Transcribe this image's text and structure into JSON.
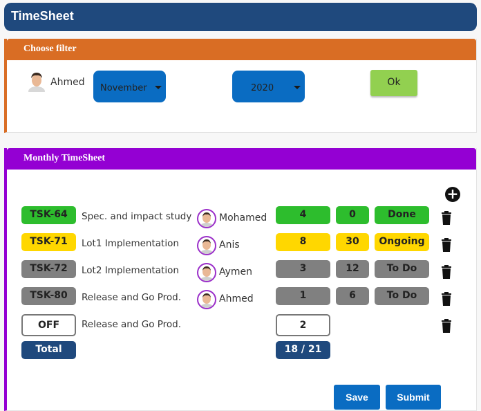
{
  "app": {
    "title": "TimeSheet"
  },
  "filter": {
    "header": "Choose filter",
    "user": "Ahmed",
    "month": "November",
    "year": "2020",
    "ok_label": "Ok"
  },
  "monthly": {
    "header": "Monthly TimeSheet",
    "rows": [
      {
        "task": "TSK-64",
        "desc": "Spec. and impact study",
        "assignee": "Mohamed",
        "days": "4",
        "remaining": "0",
        "status": "Done",
        "color": "#2dbd2d"
      },
      {
        "task": "TSK-71",
        "desc": "Lot1 Implementation",
        "assignee": "Anis",
        "days": "8",
        "remaining": "30",
        "status": "Ongoing",
        "color": "#ffd700"
      },
      {
        "task": "TSK-72",
        "desc": "Lot2 Implementation",
        "assignee": "Aymen",
        "days": "3",
        "remaining": "12",
        "status": "To Do",
        "color": "#808080"
      },
      {
        "task": "TSK-80",
        "desc": "Release and Go Prod.",
        "assignee": "Ahmed",
        "days": "1",
        "remaining": "6",
        "status": "To Do",
        "color": "#808080"
      }
    ],
    "off": {
      "label": "OFF",
      "desc": "Release and Go Prod.",
      "days": "2"
    },
    "total": {
      "label": "Total",
      "value": "18 / 21"
    },
    "save_label": "Save",
    "submit_label": "Submit"
  }
}
